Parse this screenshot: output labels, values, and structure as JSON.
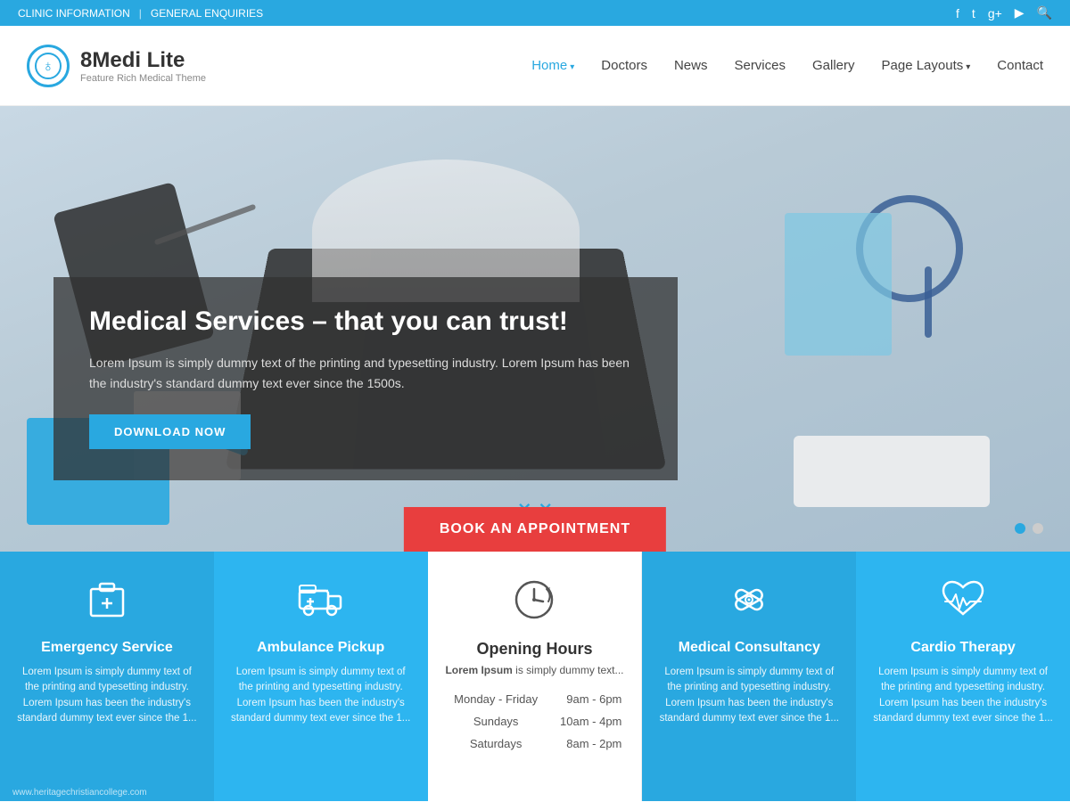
{
  "topbar": {
    "left": [
      "CLINIC INFORMATION",
      "|",
      "GENERAL ENQUIRIES"
    ],
    "icons": [
      "f",
      "t",
      "g+",
      "▶",
      "🔍"
    ]
  },
  "header": {
    "logo_symbol": "♁",
    "site_name": "8Medi Lite",
    "tagline": "Feature Rich Medical Theme",
    "nav": [
      {
        "label": "Home",
        "active": true,
        "dropdown": true
      },
      {
        "label": "Doctors",
        "active": false
      },
      {
        "label": "News",
        "active": false
      },
      {
        "label": "Services",
        "active": false
      },
      {
        "label": "Gallery",
        "active": false
      },
      {
        "label": "Page Layouts",
        "active": false,
        "dropdown": true
      },
      {
        "label": "Contact",
        "active": false
      }
    ]
  },
  "hero": {
    "title": "Medical Services – that you can trust!",
    "description": "Lorem Ipsum is simply dummy text of the printing and typesetting industry. Lorem Ipsum has been the industry's standard dummy text ever since the 1500s.",
    "cta_button": "DOWNLOAD NOW",
    "appointment_button": "BOOK AN APPOINTMENT"
  },
  "services": [
    {
      "id": "emergency",
      "icon": "🏥",
      "title": "Emergency Service",
      "desc": "Lorem Ipsum is simply dummy text of the printing and typesetting industry. Lorem Ipsum has been the industry's standard dummy text ever since the 1...",
      "theme": "blue"
    },
    {
      "id": "ambulance",
      "icon": "🚑",
      "title": "Ambulance Pickup",
      "desc": "Lorem Ipsum is simply dummy text of the printing and typesetting industry. Lorem Ipsum has been the industry's standard dummy text ever since the 1...",
      "theme": "blue2"
    },
    {
      "id": "opening",
      "icon": "🕐",
      "title": "Opening Hours",
      "intro_bold": "Lorem Ipsum",
      "intro_rest": " is simply dummy text...",
      "hours": [
        {
          "day": "Monday - Friday",
          "time": "9am - 6pm"
        },
        {
          "day": "Sundays",
          "time": "10am - 4pm"
        },
        {
          "day": "Saturdays",
          "time": "8am - 2pm"
        }
      ],
      "theme": "white"
    },
    {
      "id": "consultancy",
      "icon": "🩹",
      "title": "Medical Consultancy",
      "desc": "Lorem Ipsum is simply dummy text of the printing and typesetting industry. Lorem Ipsum has been the industry's standard dummy text ever since the 1...",
      "theme": "blue3"
    },
    {
      "id": "cardio",
      "icon": "❤",
      "title": "Cardio Therapy",
      "desc": "Lorem Ipsum is simply dummy text of the printing and typesetting industry. Lorem Ipsum has been the industry's standard dummy text ever since the 1...",
      "theme": "blue4"
    }
  ],
  "footer": {
    "url": "www.heritagechristiancollege.com"
  },
  "colors": {
    "primary": "#29a8e0",
    "red": "#e83e3e",
    "dark": "#333"
  }
}
